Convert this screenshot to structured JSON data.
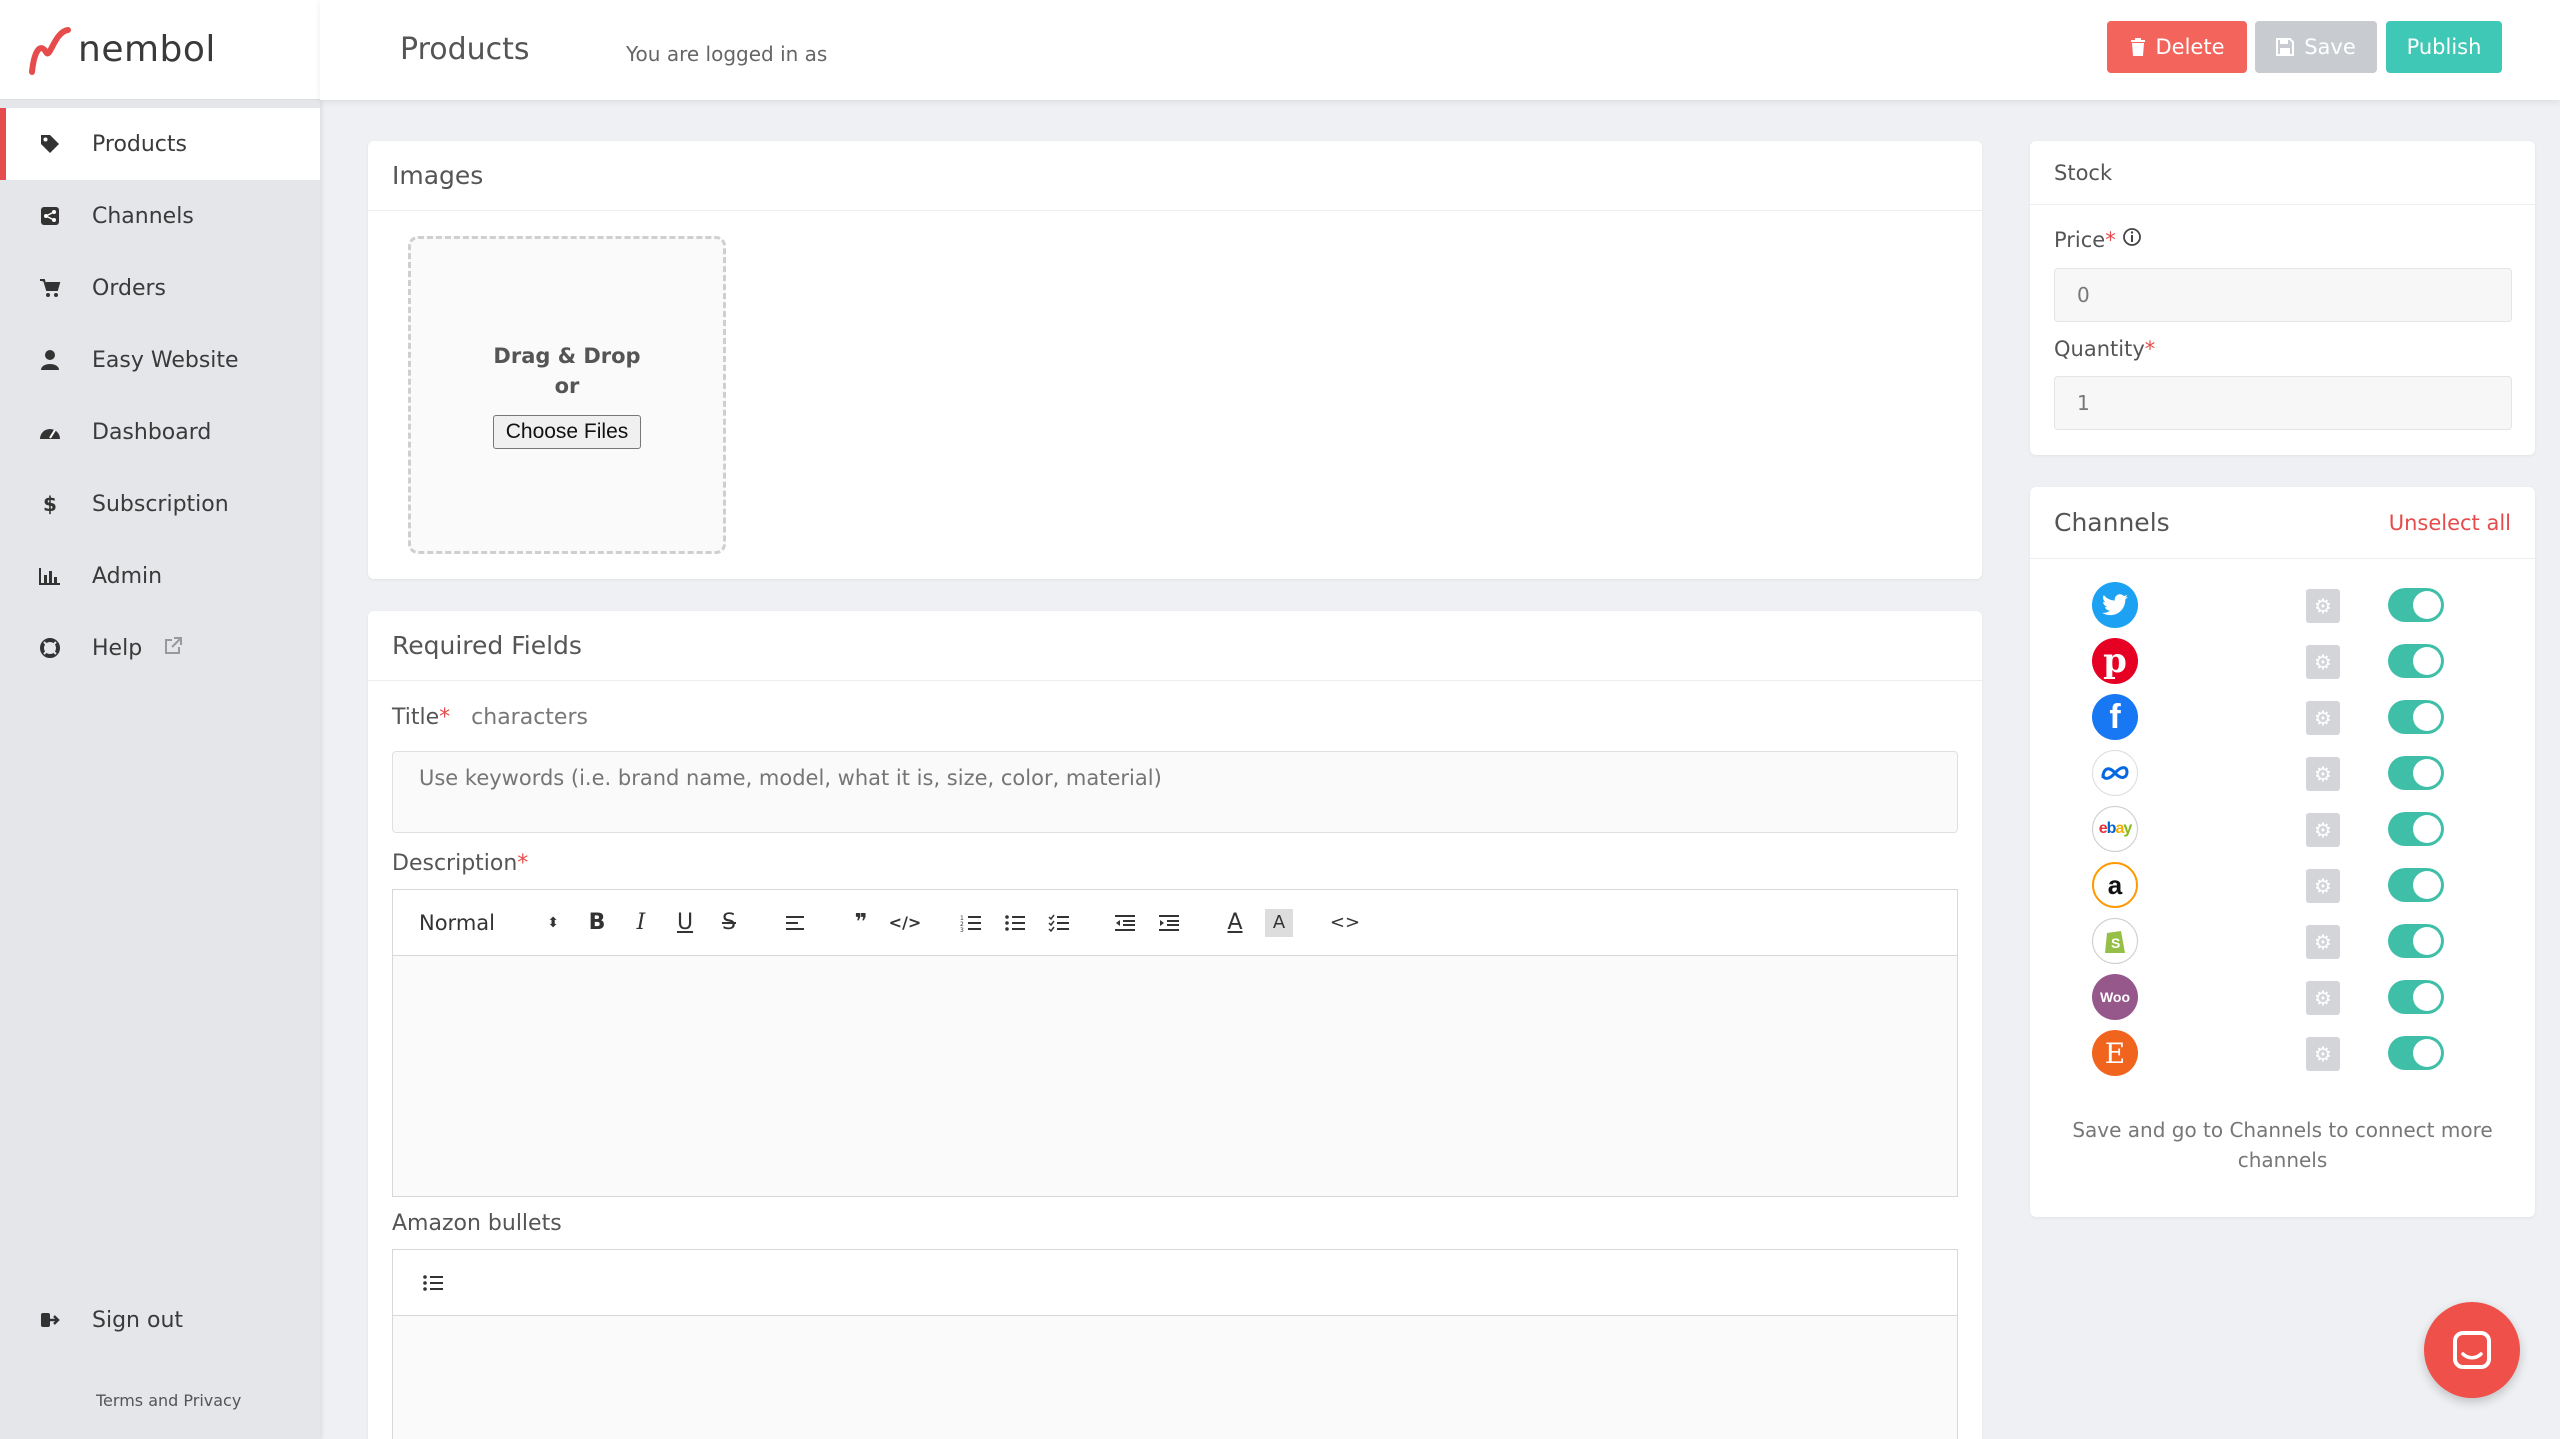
{
  "brand": {
    "name": "nembol",
    "accent": "#e74c4c"
  },
  "sidebar": {
    "items": [
      {
        "label": "Products",
        "icon": "tags-icon",
        "active": true
      },
      {
        "label": "Channels",
        "icon": "share-icon"
      },
      {
        "label": "Orders",
        "icon": "cart-icon"
      },
      {
        "label": "Easy Website",
        "icon": "user-icon"
      },
      {
        "label": "Dashboard",
        "icon": "gauge-icon"
      },
      {
        "label": "Subscription",
        "icon": "dollar-icon"
      },
      {
        "label": "Admin",
        "icon": "bar-chart-icon"
      },
      {
        "label": "Help",
        "icon": "lifebuoy-icon"
      }
    ],
    "signout": "Sign out",
    "terms": "Terms and Privacy"
  },
  "header": {
    "title": "Products",
    "logged_in": "You are logged in as",
    "delete_label": "Delete",
    "save_label": "Save",
    "publish_label": "Publish"
  },
  "images": {
    "title": "Images",
    "drag_drop": "Drag & Drop",
    "or": "or",
    "choose_files": "Choose Files"
  },
  "required": {
    "title": "Required Fields",
    "title_label": "Title",
    "title_counter": "characters",
    "title_placeholder": "Use keywords (i.e. brand name, model, what it is, size, color, material)",
    "description_label": "Description",
    "format_select": "Normal",
    "amazon_bullets_label": "Amazon bullets"
  },
  "stock": {
    "title": "Stock",
    "price_label": "Price",
    "price_value": "0",
    "quantity_label": "Quantity",
    "quantity_value": "1"
  },
  "channels": {
    "title": "Channels",
    "unselect_all": "Unselect all",
    "list": [
      {
        "name": "twitter",
        "color": "#1da1f2",
        "enabled": true
      },
      {
        "name": "pinterest",
        "color": "#e60023",
        "enabled": true
      },
      {
        "name": "facebook",
        "color": "#1877f2",
        "enabled": true
      },
      {
        "name": "meta",
        "color": "#0668e1",
        "enabled": true
      },
      {
        "name": "ebay",
        "color": "#e53238",
        "enabled": true
      },
      {
        "name": "amazon",
        "color": "#ff9900",
        "enabled": true
      },
      {
        "name": "shopify",
        "color": "#95bf47",
        "enabled": true
      },
      {
        "name": "woocommerce",
        "color": "#96588a",
        "enabled": true
      },
      {
        "name": "etsy",
        "color": "#f1641e",
        "enabled": true
      }
    ],
    "note": "Save and go to Channels to connect more channels"
  }
}
